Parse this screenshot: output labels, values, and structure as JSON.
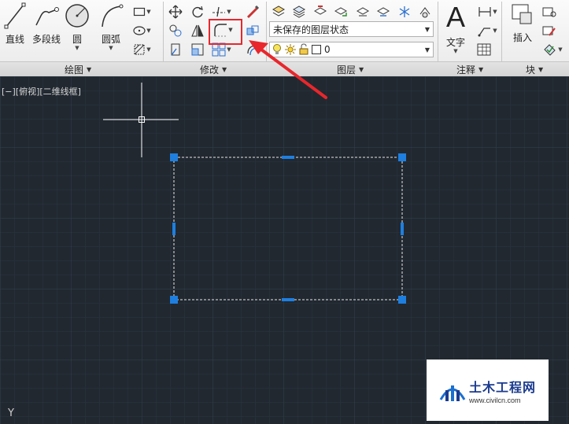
{
  "viewport_label": "[−][俯视][二维线框]",
  "ucs_icon_label": "Y",
  "ribbon": {
    "draw_panel": {
      "title": "绘图",
      "line": "直线",
      "polyline": "多段线",
      "circle": "圆",
      "arc": "圆弧"
    },
    "modify_panel": {
      "title": "修改"
    },
    "layers_panel": {
      "title": "图层",
      "layer_state_value": "未保存的图层状态",
      "current_layer_value": "0"
    },
    "annotation_panel": {
      "title": "注释",
      "text": "文字"
    },
    "block_panel": {
      "title": "块",
      "insert": "插入"
    }
  },
  "watermark": {
    "title": "土木工程网",
    "url": "www.civilcn.com"
  },
  "colors": {
    "canvas_background": "#212830",
    "grip_blue": "#1e7fe0",
    "highlight_red": "#e8272c",
    "ribbon_background": "#f2f2f2"
  }
}
